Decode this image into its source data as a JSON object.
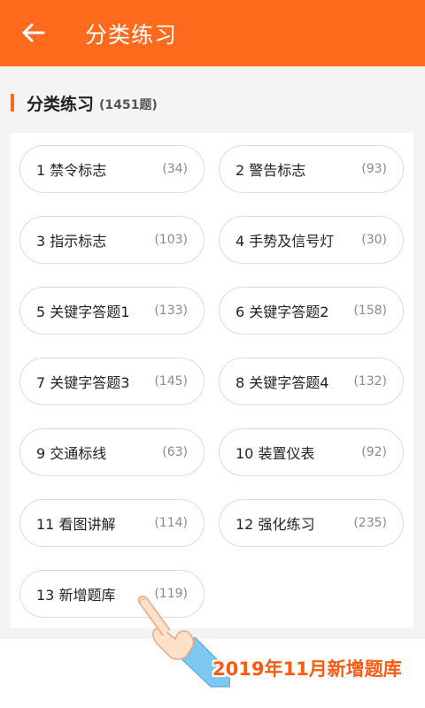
{
  "appbar": {
    "title": "分类练习",
    "back_icon": "arrow-left-icon",
    "bg_color": "#ff6a1c"
  },
  "section": {
    "title": "分类练习",
    "count": "(1451题)",
    "accent_color": "#ff6a1c"
  },
  "categories": [
    {
      "label": "1 禁令标志",
      "count": "(34)"
    },
    {
      "label": "2 警告标志",
      "count": "(93)"
    },
    {
      "label": "3 指示标志",
      "count": "(103)"
    },
    {
      "label": "4 手势及信号灯",
      "count": "(30)"
    },
    {
      "label": "5 关键字答题1",
      "count": "(133)"
    },
    {
      "label": "6 关键字答题2",
      "count": "(158)"
    },
    {
      "label": "7 关键字答题3",
      "count": "(145)"
    },
    {
      "label": "8 关键字答题4",
      "count": "(132)"
    },
    {
      "label": "9 交通标线",
      "count": "(63)"
    },
    {
      "label": "10 装置仪表",
      "count": "(92)"
    },
    {
      "label": "11 看图讲解",
      "count": "(114)"
    },
    {
      "label": "12 强化练习",
      "count": "(235)"
    },
    {
      "label": "13 新增题库",
      "count": "(119)"
    }
  ],
  "promo": {
    "text": "2019年11月新增题库",
    "color": "#ff5a10",
    "pointer_icon": "pointing-hand-icon"
  }
}
